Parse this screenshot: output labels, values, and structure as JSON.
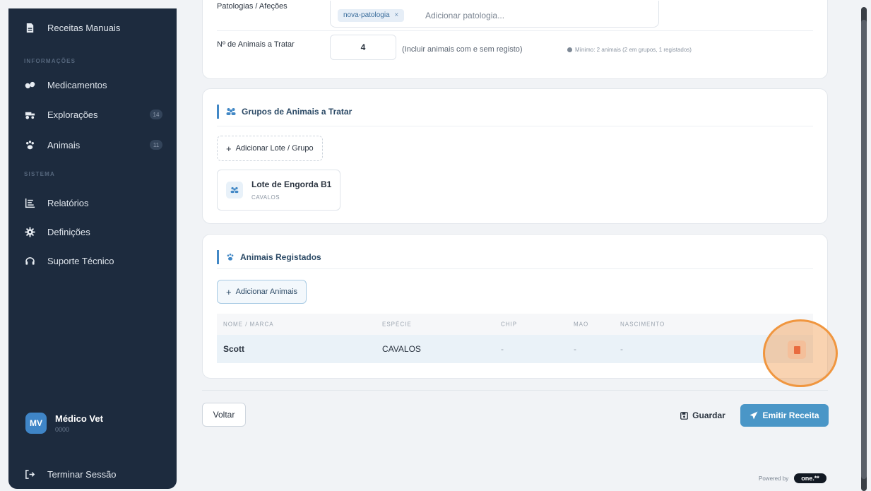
{
  "sidebar": {
    "items_top": [
      {
        "label": "Receitas Manuais",
        "icon": "document-icon"
      }
    ],
    "section_info": "INFORMAÇÕES",
    "items_info": [
      {
        "label": "Medicamentos",
        "icon": "pills-icon"
      },
      {
        "label": "Explorações",
        "icon": "tractor-icon",
        "badge": "14"
      },
      {
        "label": "Animais",
        "icon": "paw-icon",
        "badge": "11"
      }
    ],
    "section_system": "SISTEMA",
    "items_system": [
      {
        "label": "Relatórios",
        "icon": "report-icon"
      },
      {
        "label": "Definições",
        "icon": "gear-icon"
      },
      {
        "label": "Suporte Técnico",
        "icon": "headset-icon"
      }
    ],
    "user": {
      "initials": "MV",
      "name": "Médico Vet",
      "code": "0000"
    },
    "logout": "Terminar Sessão"
  },
  "form": {
    "patologias_label": "Patologias / Afeções",
    "patologia_chip": "nova-patologia",
    "patologia_chip_remove": "×",
    "patologia_placeholder": "Adicionar patologia...",
    "animals_count_label": "Nº de Animais a Tratar",
    "animals_count_value": "4",
    "animals_count_hint": "(Incluir animais com e sem registo)",
    "animals_min_hint": "Mínimo: 2 animais (2 em grupos, 1 registados)"
  },
  "groups": {
    "title": "Grupos de Animais a Tratar",
    "add_button": "Adicionar Lote / Grupo",
    "lote": {
      "name": "Lote de Engorda B1",
      "species": "CAVALOS"
    }
  },
  "registered": {
    "title": "Animais Registados",
    "add_button": "Adicionar Animais",
    "columns": [
      "NOME / MARCA",
      "ESPÉCIE",
      "CHIP",
      "MAO",
      "NASCIMENTO"
    ],
    "rows": [
      {
        "nome": "Scott",
        "especie": "CAVALOS",
        "chip": "-",
        "mao": "-",
        "nascimento": "-"
      }
    ]
  },
  "actions": {
    "back": "Voltar",
    "save": "Guardar",
    "emit": "Emitir Receita"
  },
  "footer": {
    "powered_by": "Powered by",
    "brand": "one.**"
  },
  "colors": {
    "sidebar_bg": "#1d2b3e",
    "accent": "#4288c6",
    "emit_button": "#4a96c7",
    "danger": "#e34d3b",
    "highlight": "#f0963f"
  }
}
